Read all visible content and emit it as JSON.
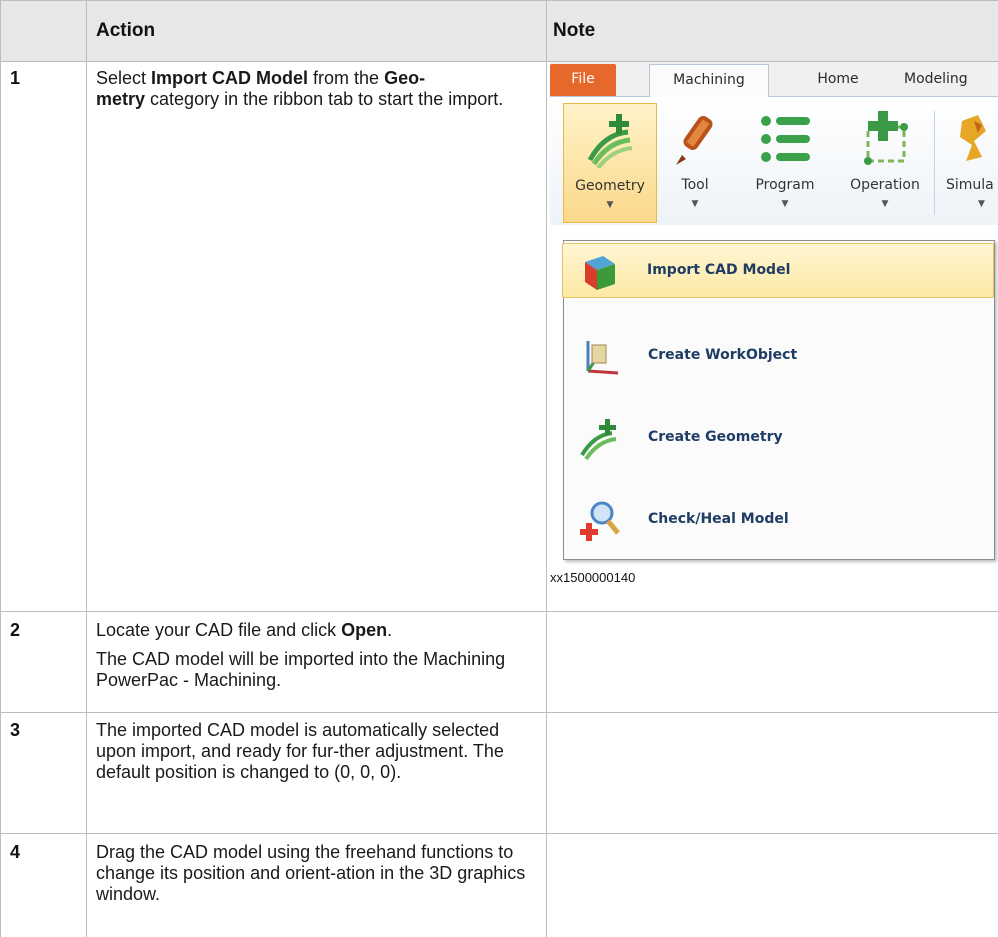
{
  "table": {
    "headers": {
      "step": "",
      "action": "Action",
      "note": "Note"
    },
    "rows": [
      {
        "step": "1",
        "action_parts": [
          "Select ",
          "Import CAD Model",
          " from the ",
          "Geo-\nmetry",
          " category in the ribbon tab to start the import."
        ],
        "action_full": "Select Import CAD Model from the Geometry category in the ribbon tab to start the import.",
        "note_caption": "xx1500000140"
      },
      {
        "step": "2",
        "action_line1_prefix": "Locate your CAD file and click ",
        "action_line1_bold": "Open",
        "action_line1_suffix": ".",
        "action_line2": "The CAD model will be imported into the Machining PowerPac - Machining."
      },
      {
        "step": "3",
        "action": "The imported CAD model is automatically selected upon import, and ready for fur-ther adjustment. The default position is changed to (0, 0, 0)."
      },
      {
        "step": "4",
        "action": "Drag the CAD model using the freehand functions to change its position and orient-ation in the 3D graphics window."
      }
    ]
  },
  "screenshot": {
    "tabs": [
      "File",
      "Machining",
      "Home",
      "Modeling"
    ],
    "ribbon_buttons": [
      "Geometry",
      "Tool",
      "Program",
      "Operation",
      "Simula"
    ],
    "menu_items": [
      "Import CAD Model",
      "Create WorkObject",
      "Create Geometry",
      "Check/Heal Model"
    ],
    "icons": {
      "geometry": "geometry-icon",
      "tool": "tool-icon",
      "program": "program-icon",
      "operation": "operation-icon",
      "simulation": "simulation-icon",
      "import": "import-cad-icon",
      "workobject": "workobject-icon",
      "create_geometry": "create-geometry-icon",
      "check_heal": "check-heal-icon"
    },
    "colors": {
      "file_tab": "#e6682a",
      "active_highlight": "#fde9a6",
      "menu_text": "#1f3c64"
    }
  }
}
